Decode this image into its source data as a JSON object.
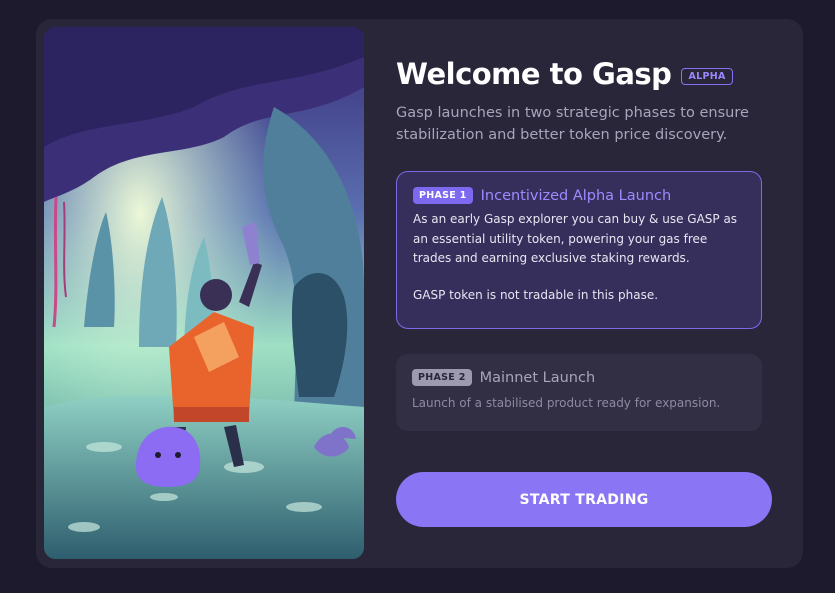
{
  "welcome": {
    "title": "Welcome to Gasp",
    "badge": "ALPHA",
    "subtitle": "Gasp launches in two strategic phases to ensure stabilization and better token price discovery."
  },
  "phases": [
    {
      "tag": "PHASE 1",
      "name": "Incentivized Alpha Launch",
      "description": "As an early Gasp explorer you can buy & use GASP as an essential utility token, powering your gas free trades and earning exclusive staking rewards.",
      "note": "GASP token is not tradable in this phase.",
      "active": true
    },
    {
      "tag": "PHASE 2",
      "name": "Mainnet Launch",
      "description": "Launch of a stabilised product ready for expansion.",
      "active": false
    }
  ],
  "cta": {
    "label": "START TRADING"
  },
  "colors": {
    "background": "#1d1a2e",
    "modal": "#2a2639",
    "accent": "#8a76f5",
    "active_phase_bg": "#362f5c",
    "active_phase_border": "#7e6ae6"
  },
  "illustration": {
    "name": "cave-explorer-illustration"
  }
}
